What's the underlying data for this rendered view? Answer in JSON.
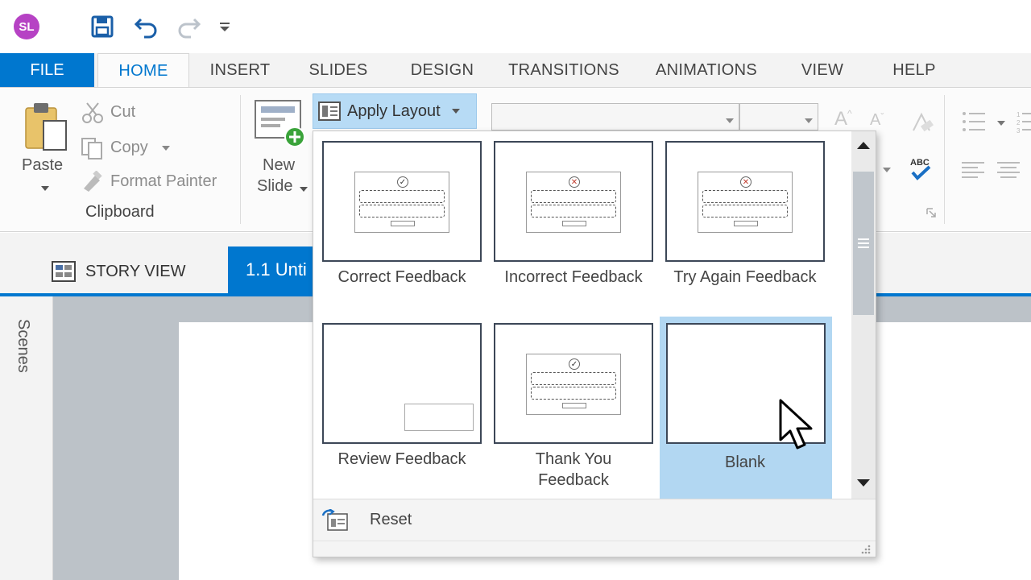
{
  "app": {
    "logo_text": "SL"
  },
  "quick_access": {
    "save_icon": "save-icon",
    "undo_icon": "undo-icon",
    "redo_icon": "redo-icon",
    "customize_icon": "customize-dropdown-icon"
  },
  "tabs": {
    "file": "FILE",
    "home": "HOME",
    "insert": "INSERT",
    "slides": "SLIDES",
    "design": "DESIGN",
    "transitions": "TRANSITIONS",
    "animations": "ANIMATIONS",
    "view": "VIEW",
    "help": "HELP"
  },
  "ribbon": {
    "paste": "Paste",
    "cut": "Cut",
    "copy": "Copy",
    "format_painter": "Format Painter",
    "clipboard_group": "Clipboard",
    "new_slide_line1": "New",
    "new_slide_line2": "Slide",
    "apply_layout": "Apply Layout"
  },
  "workspace": {
    "story_view": "STORY VIEW",
    "slide_tab": "1.1 Unti",
    "scenes": "Scenes"
  },
  "layout_gallery": {
    "items": [
      {
        "label": "Correct Feedback",
        "line2": ""
      },
      {
        "label": "Incorrect Feedback",
        "line2": ""
      },
      {
        "label": "Try Again Feedback",
        "line2": ""
      },
      {
        "label": "Review Feedback",
        "line2": ""
      },
      {
        "label": "Thank You",
        "line2": "Feedback"
      },
      {
        "label": "Blank",
        "line2": ""
      }
    ],
    "selected": "Blank",
    "reset": "Reset"
  },
  "colors": {
    "accent": "#0077cf",
    "selection": "#b2d7f2",
    "logo": "#b642c4"
  }
}
